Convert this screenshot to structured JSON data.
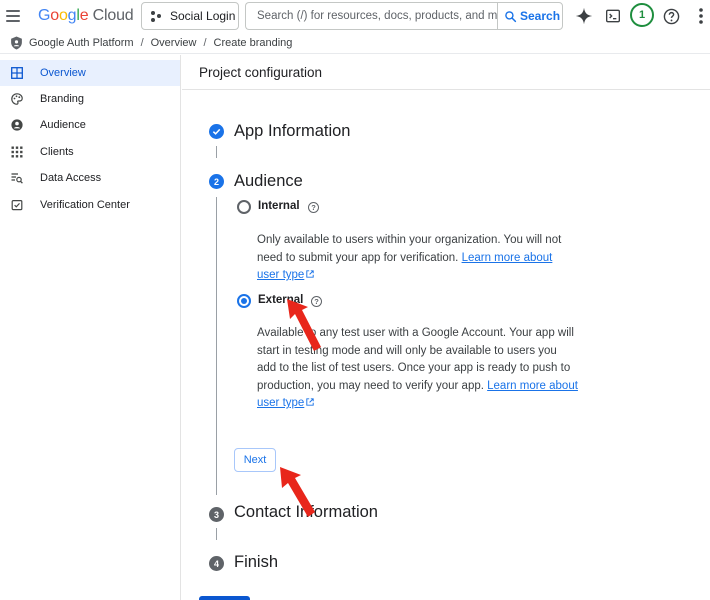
{
  "topbar": {
    "logo": {
      "g1": "G",
      "g2": "o",
      "g3": "o",
      "g4": "g",
      "g5": "l",
      "g6": "e",
      "cloud": "Cloud"
    },
    "project": "Social Login",
    "search_placeholder": "Search (/) for resources, docs, products, and more",
    "search_label": "Search",
    "notification_count": "1"
  },
  "breadcrumb": [
    "Google Auth Platform",
    "Overview",
    "Create branding"
  ],
  "sidebar": {
    "items": [
      {
        "label": "Overview",
        "icon": "dashboard-icon",
        "active": true
      },
      {
        "label": "Branding",
        "icon": "palette-icon",
        "active": false
      },
      {
        "label": "Audience",
        "icon": "person-icon",
        "active": false
      },
      {
        "label": "Clients",
        "icon": "grid-icon",
        "active": false
      },
      {
        "label": "Data Access",
        "icon": "data-access-icon",
        "active": false
      },
      {
        "label": "Verification Center",
        "icon": "verification-icon",
        "active": false
      }
    ]
  },
  "main": {
    "header_title": "Project configuration",
    "steps": [
      {
        "number": "",
        "title": "App Information",
        "state": "completed"
      },
      {
        "number": "2",
        "title": "Audience",
        "state": "active"
      },
      {
        "number": "3",
        "title": "Contact Information",
        "state": "pending"
      },
      {
        "number": "4",
        "title": "Finish",
        "state": "pending"
      }
    ],
    "audience": {
      "internal": {
        "label": "Internal",
        "desc_line1": "Only available to users within your organization. You will not",
        "desc_line2": "need to submit your app for verification.",
        "link_part1": "Learn more about",
        "link_part2": "user type",
        "selected": false
      },
      "external": {
        "label": "External",
        "desc_line1": "Available to any test user with a Google Account. Your app will",
        "desc_line2": "start in testing mode and will only be available to users you",
        "desc_line3": "add to the list of test users. Once your app is ready to push to",
        "desc_line4": "production, you may need to verify your app.",
        "link_part1": "Learn more about",
        "link_part2": "user type",
        "selected": true
      }
    },
    "next_label": "Next"
  },
  "colors": {
    "accent": "#1a73e8",
    "completed": "#1a73e8",
    "pending": "#5f6368",
    "active_nav_bg": "#e8f0fe",
    "annotation_arrow": "#e8261b"
  }
}
